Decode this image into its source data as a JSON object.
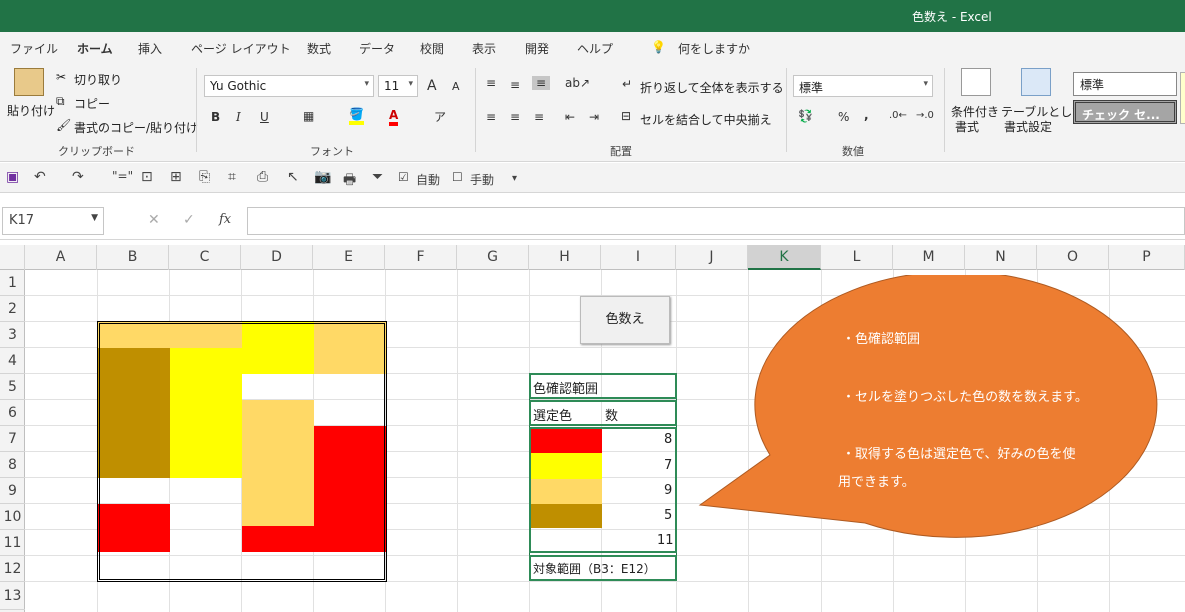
{
  "window": {
    "title": "色数え  -  Excel"
  },
  "menu": [
    "ファイル",
    "ホーム",
    "挿入",
    "ページ レイアウト",
    "数式",
    "データ",
    "校閲",
    "表示",
    "開発",
    "ヘルプ"
  ],
  "menu_search": "何をしますか",
  "ribbon": {
    "clipboard": {
      "paste": "貼り付け",
      "cut": "切り取り",
      "copy": "コピー",
      "format_painter": "書式のコピー/貼り付け",
      "label": "クリップボード"
    },
    "font": {
      "name": "Yu Gothic",
      "size": "11",
      "grow": "A",
      "shrink": "A",
      "bold": "B",
      "italic": "I",
      "underline": "U",
      "label": "フォント"
    },
    "alignment": {
      "wrap": "折り返して全体を表示する",
      "merge": "セルを結合して中央揃え",
      "label": "配置"
    },
    "number": {
      "format": "標準",
      "percent": "%",
      "comma": ",",
      "label": "数値"
    },
    "styles": {
      "conditional": "条件付き",
      "conditional2": "書式",
      "table": "テーブルとして",
      "table2": "書式設定",
      "normal": "標準",
      "check": "チェック セ..."
    }
  },
  "qat": {
    "auto": "自動",
    "manual": "手動"
  },
  "formula_bar": {
    "name_box": "K17",
    "fx": "fx",
    "cancel": "✕",
    "enter": "✓"
  },
  "columns": [
    "A",
    "B",
    "C",
    "D",
    "E",
    "F",
    "G",
    "H",
    "I",
    "J",
    "K",
    "L",
    "M",
    "N",
    "O",
    "P"
  ],
  "selected_column": "K",
  "rows": [
    "1",
    "2",
    "3",
    "4",
    "5",
    "6",
    "7",
    "8",
    "9",
    "10",
    "11",
    "12",
    "13"
  ],
  "colors": {
    "red": "#FF0000",
    "yellow": "#FFFF00",
    "light_orange": "#FFD966",
    "dark_gold": "#BF8F00",
    "excel_green": "#217346",
    "callout": "#ED7D31"
  },
  "button": {
    "label": "色数え"
  },
  "summary_table": {
    "title": "色確認範囲",
    "headers": [
      "選定色",
      "数"
    ],
    "rows": [
      {
        "color": "#FF0000",
        "count": "8"
      },
      {
        "color": "#FFFF00",
        "count": "7"
      },
      {
        "color": "#FFD966",
        "count": "9"
      },
      {
        "color": "#BF8F00",
        "count": "5"
      },
      {
        "color": "",
        "count": "11"
      }
    ],
    "footer": "対象範囲（B3：E12）"
  },
  "callout": {
    "line1": "・色確認範囲",
    "line2": "・セルを塗りつぶした色の数を数えます。",
    "line3": "・取得する色は選定色で、好みの色を使",
    "line4": "用できます。"
  }
}
